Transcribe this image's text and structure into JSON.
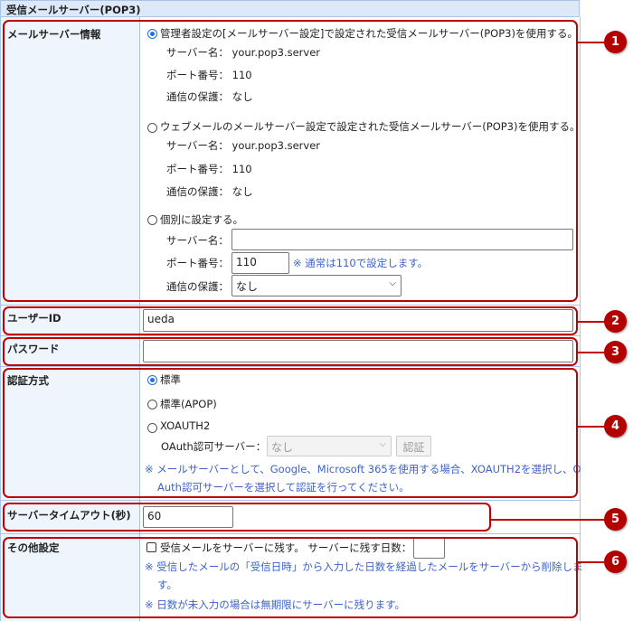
{
  "section_title": "受信メールサーバー(POP3)",
  "mail_server": {
    "label": "メールサーバー情報",
    "option_admin": "管理者設定の[メールサーバー設定]で設定された受信メールサーバー(POP3)を使用する。",
    "option_webmail": "ウェブメールのメールサーバー設定で設定された受信メールサーバー(POP3)を使用する。",
    "option_custom": "個別に設定する。",
    "server_name_label": "サーバー名：",
    "port_label": "ポート番号：",
    "security_label": "通信の保護：",
    "admin": {
      "server": "your.pop3.server",
      "port": "110",
      "security": "なし"
    },
    "webmail": {
      "server": "your.pop3.server",
      "port": "110",
      "security": "なし"
    },
    "custom": {
      "server": "",
      "port": "110",
      "port_note": "※ 通常は110で設定します。",
      "security": "なし"
    },
    "selected": "admin"
  },
  "user_id": {
    "label": "ユーザーID",
    "value": "ueda"
  },
  "password": {
    "label": "パスワード",
    "value": ""
  },
  "auth": {
    "label": "認証方式",
    "options": [
      "標準",
      "標準(APOP)",
      "XOAUTH2"
    ],
    "selected": "標準",
    "oauth_label": "OAuth認可サーバー：",
    "oauth_value": "なし",
    "auth_button": "認証",
    "note1": "※ メールサーバーとして、Google、Microsoft 365を使用する場合、XOAUTH2を選択し、O",
    "note2": "Auth認可サーバーを選択して認証を行ってください。"
  },
  "timeout": {
    "label": "サーバータイムアウト(秒)",
    "value": "60"
  },
  "other": {
    "label": "その他設定",
    "keep_label": "受信メールをサーバーに残す。",
    "days_label": "サーバーに残す日数：",
    "days_value": "",
    "keep_checked": false,
    "note1": "※ 受信したメールの「受信日時」から入力した日数を経過したメールをサーバーから削除しま",
    "note1b": "す。",
    "note2": "※ 日数が未入力の場合は無期限にサーバーに残ります。"
  },
  "callouts": [
    "1",
    "2",
    "3",
    "4",
    "5",
    "6"
  ],
  "colors": {
    "accent": "#c00000",
    "note": "#3e63c8",
    "label_bg": "#eef5fd"
  }
}
